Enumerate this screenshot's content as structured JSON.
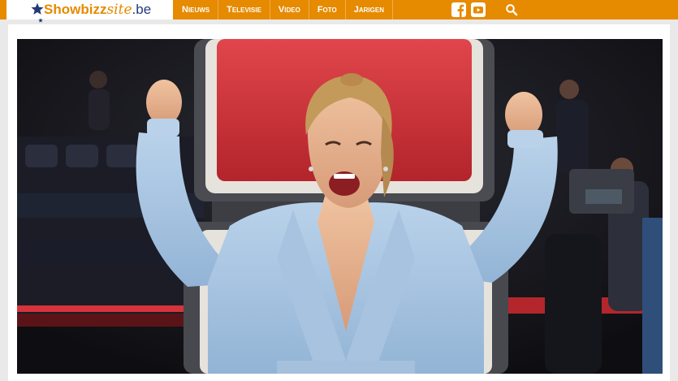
{
  "site": {
    "logo_part1": "Showbizz",
    "logo_part2": "site",
    "logo_part3": ".be"
  },
  "nav": {
    "items": [
      {
        "label": "Nieuws"
      },
      {
        "label": "Televisie"
      },
      {
        "label": "Video"
      },
      {
        "label": "Foto"
      },
      {
        "label": "Jarigen"
      }
    ]
  },
  "icons": {
    "facebook": "facebook-icon",
    "youtube": "youtube-icon",
    "search": "search-icon"
  },
  "colors": {
    "accent": "#e68a00",
    "brand_dark": "#233a7a",
    "chair_red": "#d2323a"
  }
}
